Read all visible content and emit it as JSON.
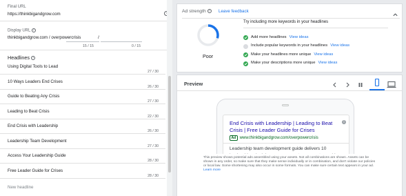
{
  "final_url": {
    "label": "Final URL",
    "value": "https://thinkbigandgrow.com"
  },
  "display_url": {
    "label": "Display URL",
    "base": "thinkbigandgrow.com",
    "path1": "overpowercrisis",
    "slash": "/",
    "count1": "15 / 15",
    "count2": "0 / 15"
  },
  "headlines": {
    "title": "Headlines",
    "items": [
      {
        "text": "Using Digital Tools to Lead",
        "count": "27 / 30"
      },
      {
        "text": "10 Ways Leaders End Crises",
        "count": "26 / 30"
      },
      {
        "text": "Guide to Beating Any Crisis",
        "count": "27 / 30"
      },
      {
        "text": "Leading to Beat Crisis",
        "count": "22 / 30"
      },
      {
        "text": "End Crisis with Leadership",
        "count": "26 / 30"
      },
      {
        "text": "Leadership Team Development",
        "count": "27 / 30"
      },
      {
        "text": "Access Your Leadership Guide",
        "count": "28 / 30"
      },
      {
        "text": "Free Leader Guide for Crises",
        "count": "28 / 30"
      }
    ],
    "new_placeholder": "New headline"
  },
  "ad_strength": {
    "title": "Ad strength",
    "feedback": "Leave feedback",
    "rating": "Poor",
    "progress": 0.3,
    "intro": "Try including more keywords in your headlines",
    "tips": [
      {
        "text": "Add more headlines",
        "link": "View ideas",
        "done": true
      },
      {
        "text": "Include popular keywords in your headlines",
        "link": "View ideas",
        "done": false
      },
      {
        "text": "Make your headlines more unique",
        "link": "View ideas",
        "done": true
      },
      {
        "text": "Make your descriptions more unique",
        "link": "View ideas",
        "done": true
      }
    ]
  },
  "preview": {
    "title": "Preview",
    "ad_title": "End Crisis with Leadership | Leading to Beat Crisis | Free Leader Guide for Crises",
    "ad_badge": "Ad",
    "ad_url": "www.thinkbigandgrow.com/overpowercrisis",
    "ad_desc": "Leadership team development guide delivers 10 leadership principles you can use tomorrow. to enable executive leaders to beat any national or global crisis. Get yours now.",
    "disclaimer": "This preview shows potential ads assembled using your assets. Not all combinations are shown. Assets can be shown in any order, so make sure that they make sense individually or in combination, and don't violate our policies or local law. Some shortening may also occur in some formats. You can make sure certain text appears in your ad.",
    "learn_more": "Learn more"
  },
  "colors": {
    "accent": "#1a73e8",
    "success": "#34a853",
    "link": "#1a0dab",
    "url_green": "#006621"
  }
}
